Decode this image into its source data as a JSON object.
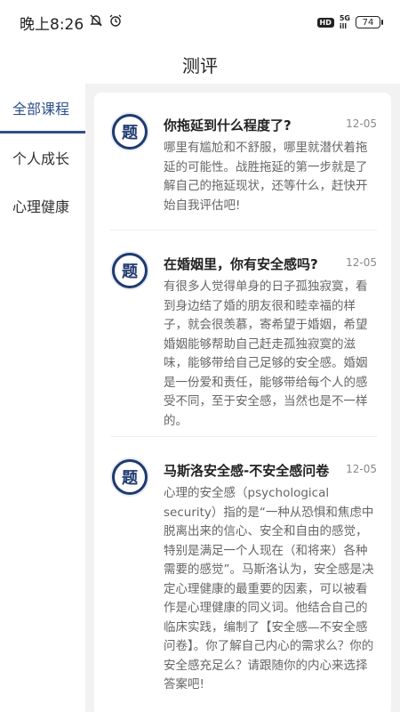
{
  "status_bar": {
    "time": "晚上8:26",
    "hd": "HD",
    "net_top": "5G",
    "net_bottom": "ill",
    "battery": "74"
  },
  "header": {
    "title": "测评"
  },
  "sidebar": {
    "items": [
      {
        "label": "全部课程",
        "active": true
      },
      {
        "label": "个人成长",
        "active": false
      },
      {
        "label": "心理健康",
        "active": false
      }
    ]
  },
  "articles": [
    {
      "avatar_char": "题",
      "title": "你拖延到什么程度了?",
      "date": "12-05",
      "desc": "哪里有尴尬和不舒服，哪里就潜伏着拖延的可能性。战胜拖延的第一步就是了解自己的拖延现状，还等什么，赶快开始自我评估吧!"
    },
    {
      "avatar_char": "题",
      "title": "在婚姻里，你有安全感吗?",
      "date": "12-05",
      "desc": "有很多人觉得单身的日子孤独寂寞，看到身边结了婚的朋友很和睦幸福的样子，就会很羡慕，寄希望于婚姻，希望婚姻能够帮助自己赶走孤独寂寞的滋味，能够带给自己足够的安全感。婚姻是一份爱和责任，能够带给每个人的感受不同，至于安全感，当然也是不一样的。"
    },
    {
      "avatar_char": "题",
      "title": "马斯洛安全感-不安全感问卷",
      "date": "12-05",
      "desc": "心理的安全感（psychological security）指的是“一种从恐惧和焦虑中脱离出来的信心、安全和自由的感觉，特别是满足一个人现在（和将来）各种需要的感觉”。马斯洛认为，安全感是决定心理健康的最重要的因素，可以被看作是心理健康的同义词。他结合自己的临床实践，编制了【安全感—不安全感问卷】。你了解自己内心的需求么？你的安全感充足么？请跟随你的内心来选择答案吧!"
    }
  ]
}
